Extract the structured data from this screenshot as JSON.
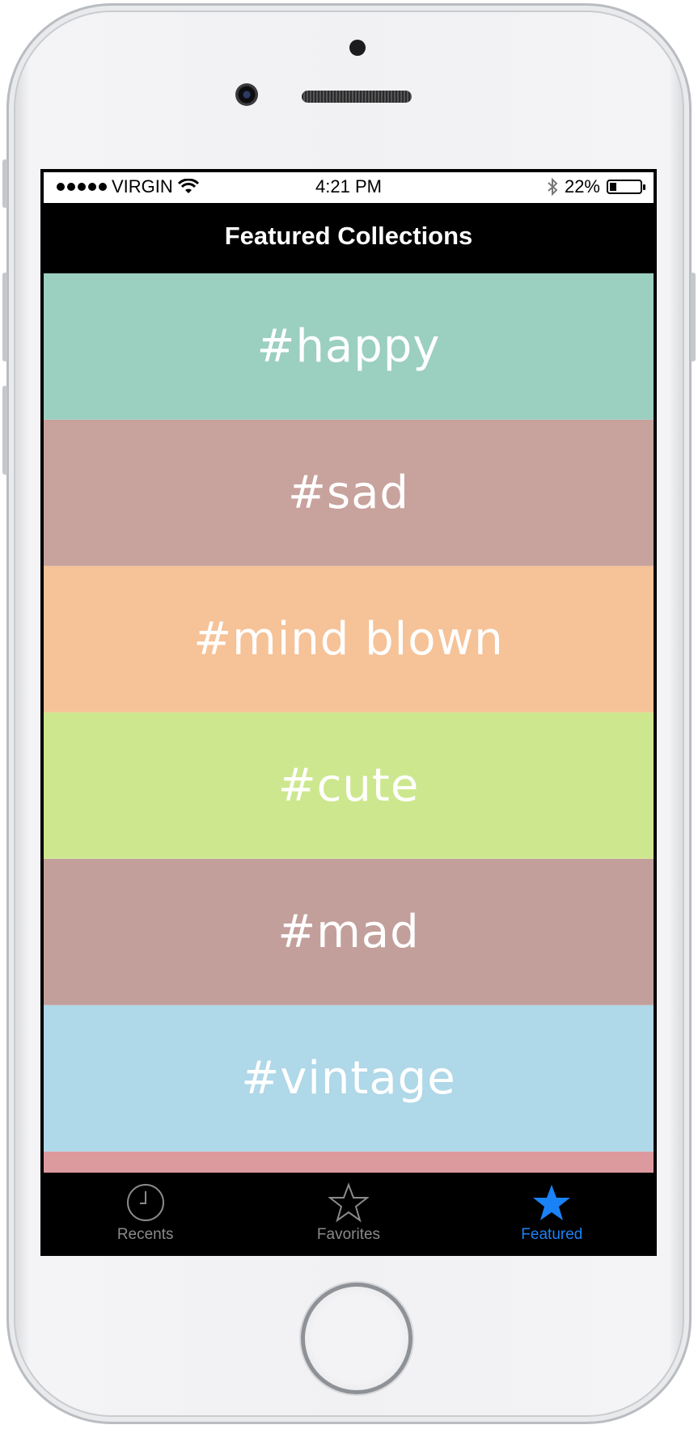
{
  "status_bar": {
    "carrier": "VIRGIN",
    "time": "4:21 PM",
    "battery": "22%",
    "battery_level": 0.22,
    "icons": [
      "signal-dots-icon",
      "wifi-icon",
      "bluetooth-icon",
      "battery-icon"
    ]
  },
  "nav": {
    "title": "Featured Collections"
  },
  "collections": [
    {
      "label": "#happy",
      "color": "#9bcfc0"
    },
    {
      "label": "#sad",
      "color": "#c8a29c"
    },
    {
      "label": "#mind blown",
      "color": "#f6c298"
    },
    {
      "label": "#cute",
      "color": "#cde78e"
    },
    {
      "label": "#mad",
      "color": "#c29f9b"
    },
    {
      "label": "#vintage",
      "color": "#afd8e8"
    },
    {
      "label": "",
      "color": "#dd9a9e"
    }
  ],
  "tabs": [
    {
      "label": "Recents",
      "icon": "clock-icon",
      "active": false
    },
    {
      "label": "Favorites",
      "icon": "star-outline-icon",
      "active": false
    },
    {
      "label": "Featured",
      "icon": "star-filled-icon",
      "active": true
    }
  ],
  "colors": {
    "accent": "#1a82f7",
    "tab_inactive": "#8a8a8a"
  }
}
